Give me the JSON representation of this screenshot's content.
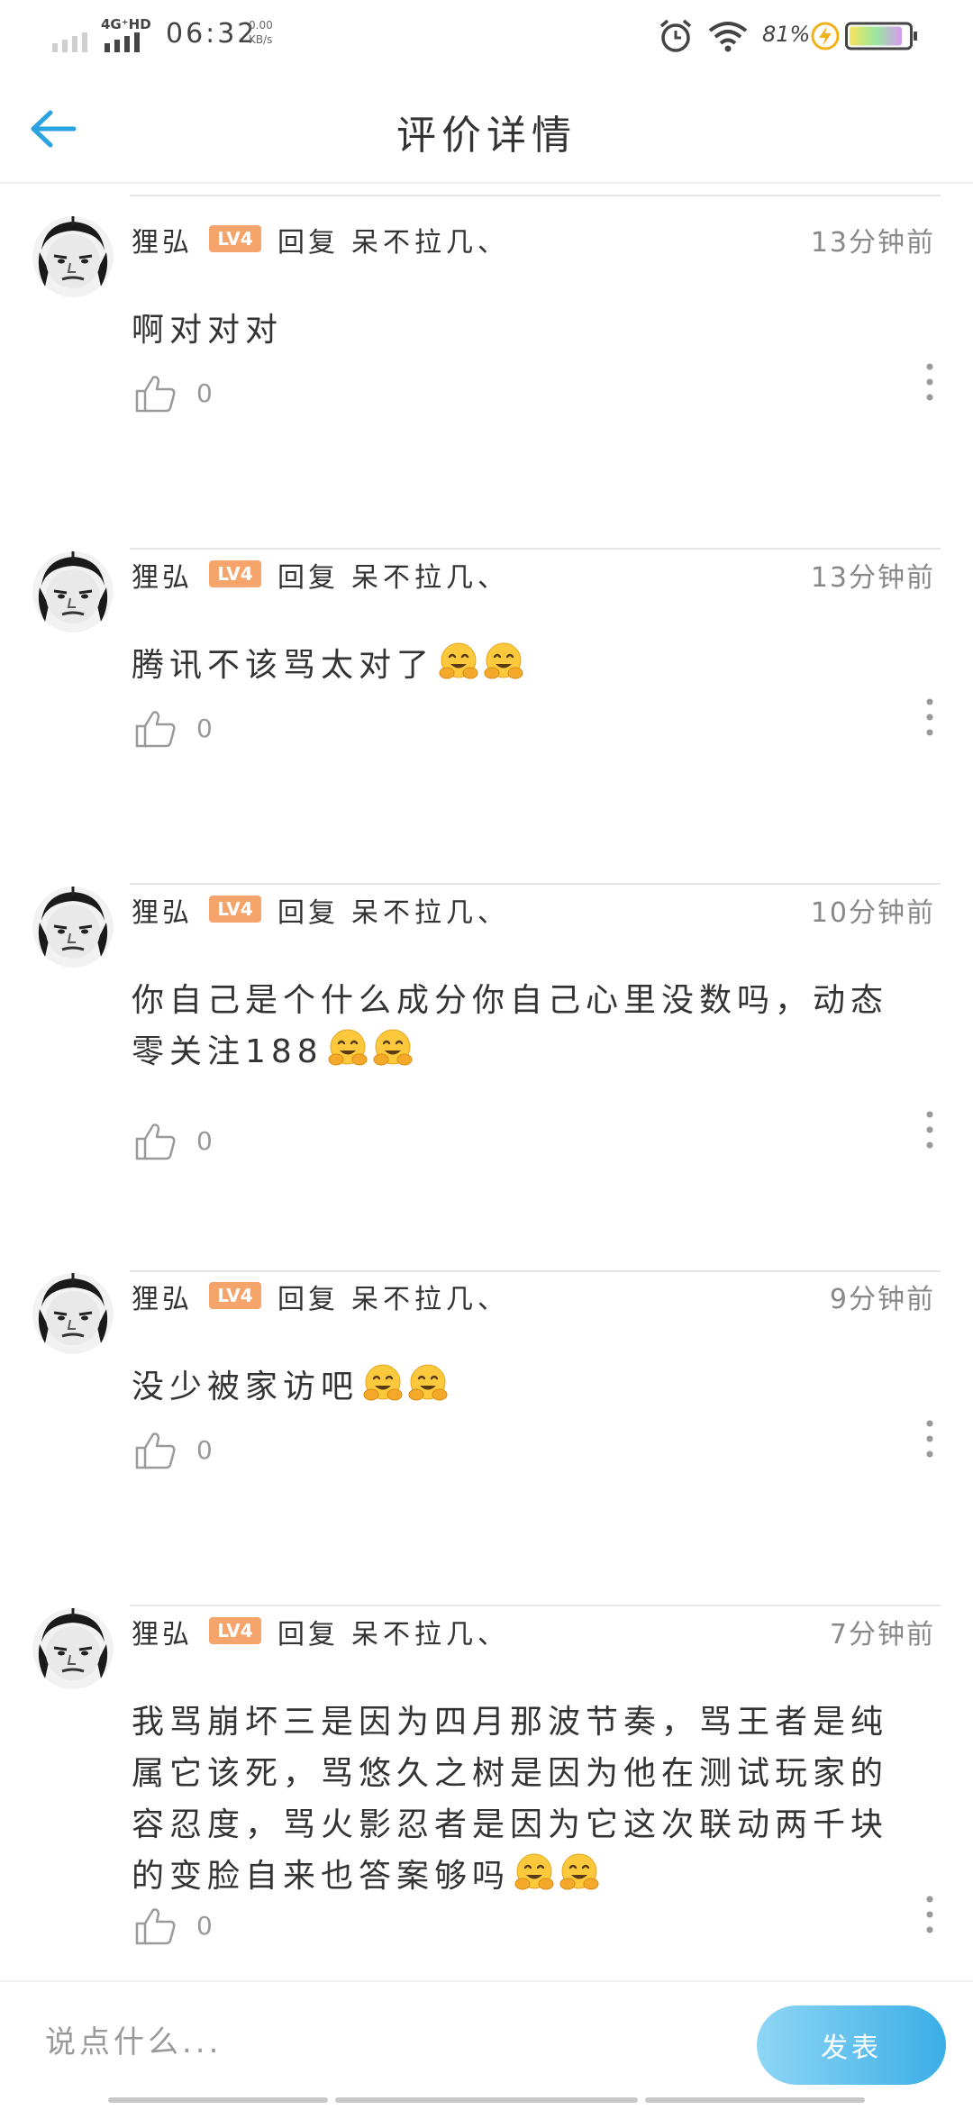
{
  "status_bar": {
    "network": "4G⁺HD",
    "time": "06:32",
    "speed_value": "0.00",
    "speed_unit": "KB/s",
    "battery_percent": "81%"
  },
  "header": {
    "title": "评价详情"
  },
  "replies": [
    {
      "name": "狸弘",
      "level": "LV4",
      "reply_word": "回复",
      "target": "呆不拉几、",
      "time": "13分钟前",
      "text": "啊对对对",
      "emoji_count": 0,
      "likes": "0"
    },
    {
      "name": "狸弘",
      "level": "LV4",
      "reply_word": "回复",
      "target": "呆不拉几、",
      "time": "13分钟前",
      "text": "腾讯不该骂太对了",
      "emoji_count": 2,
      "likes": "0"
    },
    {
      "name": "狸弘",
      "level": "LV4",
      "reply_word": "回复",
      "target": "呆不拉几、",
      "time": "10分钟前",
      "text": "你自己是个什么成分你自己心里没数吗，动态零关注188",
      "emoji_count": 2,
      "likes": "0"
    },
    {
      "name": "狸弘",
      "level": "LV4",
      "reply_word": "回复",
      "target": "呆不拉几、",
      "time": "9分钟前",
      "text": "没少被家访吧",
      "emoji_count": 2,
      "likes": "0"
    },
    {
      "name": "狸弘",
      "level": "LV4",
      "reply_word": "回复",
      "target": "呆不拉几、",
      "time": "7分钟前",
      "text": "我骂崩坏三是因为四月那波节奏，骂王者是纯属它该死，骂悠久之树是因为他在测试玩家的容忍度，骂火影忍者是因为它这次联动两千块的变脸自来也答案够吗",
      "emoji_count": 2,
      "likes": "0"
    }
  ],
  "composer": {
    "placeholder": "说点什么...",
    "send_label": "发表"
  },
  "colors": {
    "accent": "#3aaee6",
    "level_badge": "#f5a56b"
  }
}
